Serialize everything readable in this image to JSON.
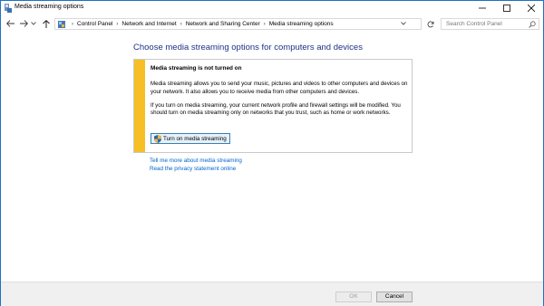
{
  "window": {
    "title": "Media streaming options",
    "icons": {
      "app": "media-stream-icon",
      "minimize": "minimize-icon",
      "maximize": "maximize-icon",
      "close": "close-icon"
    }
  },
  "nav": {
    "breadcrumbs": [
      "Control Panel",
      "Network and Internet",
      "Network and Sharing Center",
      "Media streaming options"
    ],
    "search_placeholder": "Search Control Panel",
    "icons": {
      "back": "back-arrow-icon",
      "forward": "forward-arrow-icon",
      "recent": "chevron-down-icon",
      "up": "up-arrow-icon",
      "refresh": "refresh-icon",
      "search": "search-icon"
    }
  },
  "main": {
    "heading": "Choose media streaming options for computers and devices",
    "notice": {
      "title": "Media streaming is not turned on",
      "paragraph1": "Media streaming allows you to send your music, pictures and videos to other computers and devices on your network.  It also allows you to receive media from other computers and devices.",
      "paragraph2": "If you turn on media streaming, your current network profile and firewall settings will be modified. You should turn on media streaming only on networks that you trust, such as home or work networks.",
      "button_label": "Turn on media streaming",
      "accent_color": "#f6bf26"
    },
    "links": [
      "Tell me more about media streaming",
      "Read the privacy statement online"
    ]
  },
  "footer": {
    "ok_label": "OK",
    "cancel_label": "Cancel"
  },
  "colors": {
    "heading": "#1e3287",
    "link": "#0066cc",
    "border": "#1e70c6"
  }
}
